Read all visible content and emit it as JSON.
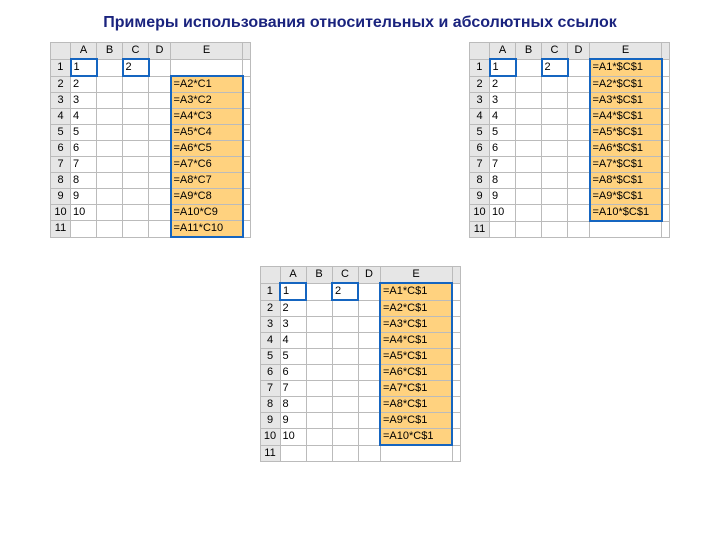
{
  "title": "Примеры использования относительных и абсолютных ссылок",
  "columns": [
    "A",
    "B",
    "C",
    "D",
    "E",
    ""
  ],
  "sheet1": {
    "a1": "1",
    "c1": "2",
    "e1": "",
    "rows": [
      {
        "n": "1",
        "a": "1",
        "c": "2",
        "e": ""
      },
      {
        "n": "2",
        "a": "2",
        "e": "=A2*C1"
      },
      {
        "n": "3",
        "a": "3",
        "e": "=A3*C2"
      },
      {
        "n": "4",
        "a": "4",
        "e": "=A4*C3"
      },
      {
        "n": "5",
        "a": "5",
        "e": "=A5*C4"
      },
      {
        "n": "6",
        "a": "6",
        "e": "=A6*C5"
      },
      {
        "n": "7",
        "a": "7",
        "e": "=A7*C6"
      },
      {
        "n": "8",
        "a": "8",
        "e": "=A8*C7"
      },
      {
        "n": "9",
        "a": "9",
        "e": "=A9*C8"
      },
      {
        "n": "10",
        "a": "10",
        "e": "=A10*C9"
      },
      {
        "n": "11",
        "a": "",
        "e": "=A11*C10"
      }
    ]
  },
  "sheet2": {
    "rows": [
      {
        "n": "1",
        "a": "1",
        "c": "2",
        "e": "=A1*$C$1"
      },
      {
        "n": "2",
        "a": "2",
        "e": "=A2*$C$1"
      },
      {
        "n": "3",
        "a": "3",
        "e": "=A3*$C$1"
      },
      {
        "n": "4",
        "a": "4",
        "e": "=A4*$C$1"
      },
      {
        "n": "5",
        "a": "5",
        "e": "=A5*$C$1"
      },
      {
        "n": "6",
        "a": "6",
        "e": "=A6*$C$1"
      },
      {
        "n": "7",
        "a": "7",
        "e": "=A7*$C$1"
      },
      {
        "n": "8",
        "a": "8",
        "e": "=A8*$C$1"
      },
      {
        "n": "9",
        "a": "9",
        "e": "=A9*$C$1"
      },
      {
        "n": "10",
        "a": "10",
        "e": "=A10*$C$1"
      },
      {
        "n": "11",
        "a": "",
        "e": ""
      }
    ]
  },
  "sheet3": {
    "rows": [
      {
        "n": "1",
        "a": "1",
        "c": "2",
        "e": "=A1*C$1"
      },
      {
        "n": "2",
        "a": "2",
        "e": "=A2*C$1"
      },
      {
        "n": "3",
        "a": "3",
        "e": "=A3*C$1"
      },
      {
        "n": "4",
        "a": "4",
        "e": "=A4*C$1"
      },
      {
        "n": "5",
        "a": "5",
        "e": "=A5*C$1"
      },
      {
        "n": "6",
        "a": "6",
        "e": "=A6*C$1"
      },
      {
        "n": "7",
        "a": "7",
        "e": "=A7*C$1"
      },
      {
        "n": "8",
        "a": "8",
        "e": "=A8*C$1"
      },
      {
        "n": "9",
        "a": "9",
        "e": "=A9*C$1"
      },
      {
        "n": "10",
        "a": "10",
        "e": "=A10*C$1"
      },
      {
        "n": "11",
        "a": "",
        "e": ""
      }
    ]
  }
}
